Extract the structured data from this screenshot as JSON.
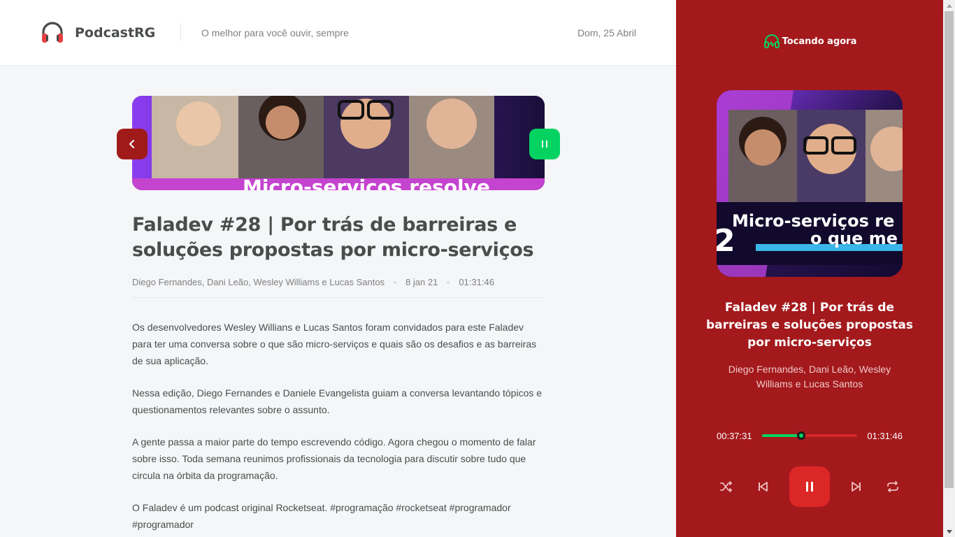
{
  "header": {
    "brand": "PodcastRG",
    "tagline": "O melhor para você ouvir, sempre",
    "date": "Dom, 25 Abril"
  },
  "episode": {
    "thumbnail_caption": "Micro-servicos resolve",
    "title": "Faladev #28 | Por trás de barreiras e soluções propostas por micro-serviços",
    "members": "Diego Fernandes, Dani Leão, Wesley Williams e Lucas Santos",
    "published_at": "8 jan 21",
    "duration": "01:31:46",
    "description": [
      "Os desenvolvedores Wesley Willians e Lucas Santos foram convidados para este Faladev para ter uma conversa sobre o que são micro-serviços e quais são os desafios e as barreiras de sua aplicação.",
      "Nessa edição, Diego Fernandes e Daniele Evangelista guiam a conversa levantando tópicos e questionamentos relevantes sobre o assunto.",
      "A gente passa a maior parte do tempo escrevendo código. Agora chegou o momento de falar sobre isso. Toda semana reunimos profissionais da tecnologia para discutir sobre tudo que circula na órbita da programação.",
      "O Faladev é um podcast original Rocketseat. #programação #rocketseat #programador #programador"
    ]
  },
  "player": {
    "heading": "Tocando agora",
    "cover_caption_line1": "Micro-serviços re",
    "cover_caption_line2": "o que me",
    "cover_number": "2",
    "title": "Faladev #28 | Por trás de barreiras e soluções propostas por micro-serviços",
    "members": "Diego Fernandes, Dani Leão, Wesley Williams e Lucas Santos",
    "current_time": "00:37:31",
    "total_time": "01:31:46",
    "progress_fraction": 0.409,
    "state": "playing"
  },
  "colors": {
    "player_bg": "#a3191c",
    "accent_green": "#04d361",
    "back_button": "#a01a1a",
    "play_button": "#dc2727",
    "text_dark": "#494d4b",
    "text_muted": "#808080"
  },
  "icons": {
    "logo": "headphones-icon",
    "back": "chevron-left-icon",
    "play_state": "pause-icon",
    "player_heading": "headphones-icon",
    "controls": [
      "shuffle-icon",
      "previous-icon",
      "pause-icon",
      "next-icon",
      "repeat-icon"
    ]
  }
}
